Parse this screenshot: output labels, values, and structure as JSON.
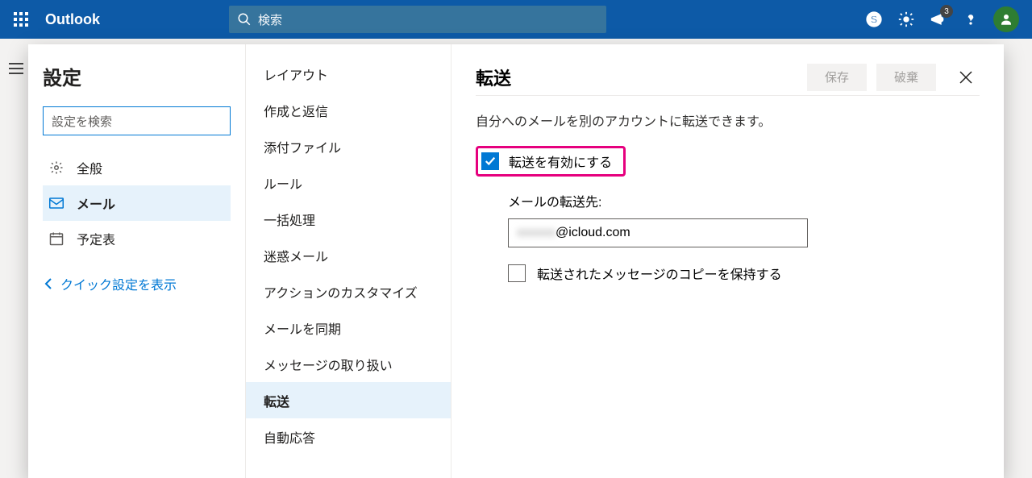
{
  "header": {
    "brand": "Outlook",
    "search_placeholder": "検索",
    "notif_badge": "3"
  },
  "settings": {
    "title": "設定",
    "search_placeholder": "設定を検索",
    "nav": {
      "general": "全般",
      "mail": "メール",
      "calendar": "予定表"
    },
    "back_link": "クイック設定を表示"
  },
  "subnav": {
    "items": [
      "レイアウト",
      "作成と返信",
      "添付ファイル",
      "ルール",
      "一括処理",
      "迷惑メール",
      "アクションのカスタマイズ",
      "メールを同期",
      "メッセージの取り扱い",
      "転送",
      "自動応答"
    ],
    "active_index": 9
  },
  "main": {
    "title": "転送",
    "save": "保存",
    "discard": "破棄",
    "desc": "自分へのメールを別のアカウントに転送できます。",
    "enable_label": "転送を有効にする",
    "enable_checked": true,
    "forward_to_label": "メールの転送先:",
    "forward_to_value_suffix": "@icloud.com",
    "keep_copy_label": "転送されたメッセージのコピーを保持する",
    "keep_copy_checked": false
  }
}
